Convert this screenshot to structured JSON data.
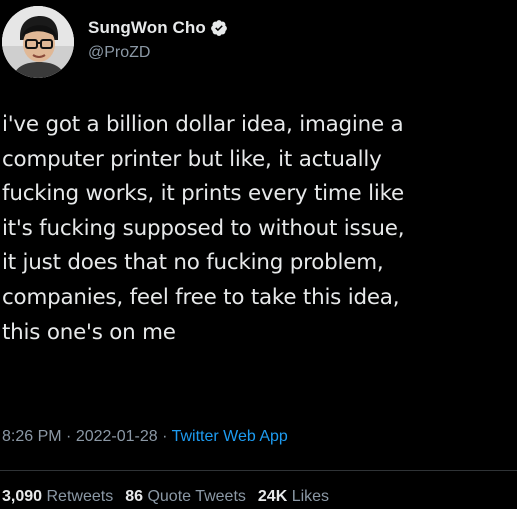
{
  "tweet": {
    "author": {
      "display_name": "SungWon Cho",
      "handle": "@ProZD",
      "verified_icon": "verified-badge-icon"
    },
    "text_lines": [
      "i've got a billion dollar idea, imagine a",
      "computer printer but like, it actually",
      "fucking works, it prints every time like",
      "it's fucking supposed to without issue,",
      "it just does that no fucking problem,",
      "companies, feel free to take this idea,",
      "this one's on me"
    ],
    "time": "8:26 PM",
    "separator": " · ",
    "date": "2022-01-28",
    "source": "Twitter Web App",
    "stats": {
      "retweets_count": "3,090",
      "retweets_label": "Retweets",
      "quote_count": "86",
      "quote_label": "Quote Tweets",
      "likes_count": "24K",
      "likes_label": "Likes"
    }
  },
  "colors": {
    "background": "#000000",
    "text": "#e7e9ea",
    "secondary": "#8b98a5",
    "link": "#1d9bf0",
    "verified": "#1d9bf0"
  }
}
